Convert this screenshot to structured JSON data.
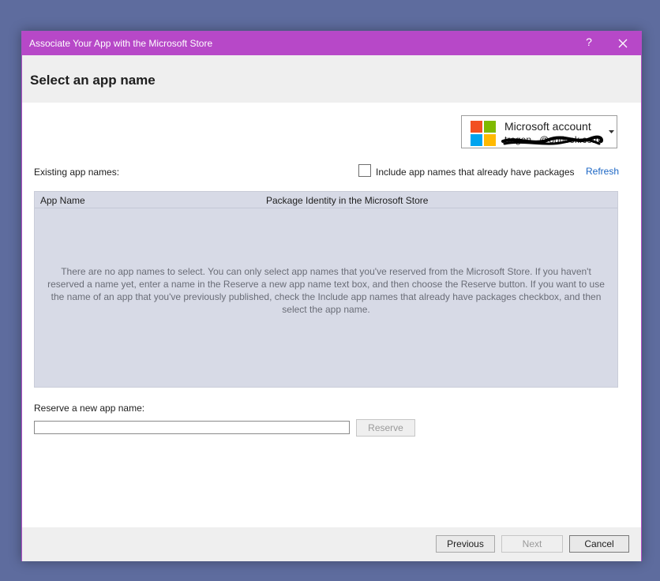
{
  "window": {
    "title": "Associate Your App with the Microsoft Store",
    "help_label": "?"
  },
  "header": {
    "heading": "Select an app name"
  },
  "account": {
    "name": "Microsoft account",
    "email": "tregen...@outlook.com",
    "logo_colors": [
      "#f25022",
      "#7fba00",
      "#00a4ef",
      "#ffb900"
    ]
  },
  "existing": {
    "label": "Existing app names:",
    "include_label": "Include app names that already have packages",
    "include_checked": false,
    "refresh_label": "Refresh"
  },
  "grid": {
    "columns": [
      "App Name",
      "Package Identity in the Microsoft Store"
    ],
    "empty_message": "There are no app names to select. You can only select app names that you've reserved from the Microsoft Store. If you haven't reserved a name yet, enter a name in the Reserve a new app name text box, and then choose the Reserve button. If you want to use the name of an app that you've previously published, check the Include app names that already have packages checkbox, and then select the app name."
  },
  "reserve": {
    "label": "Reserve a new app name:",
    "value": "",
    "button_label": "Reserve"
  },
  "footer": {
    "previous_label": "Previous",
    "next_label": "Next",
    "cancel_label": "Cancel"
  },
  "colors": {
    "title_bar": "#b748c8",
    "accent_link": "#1a65c4"
  }
}
